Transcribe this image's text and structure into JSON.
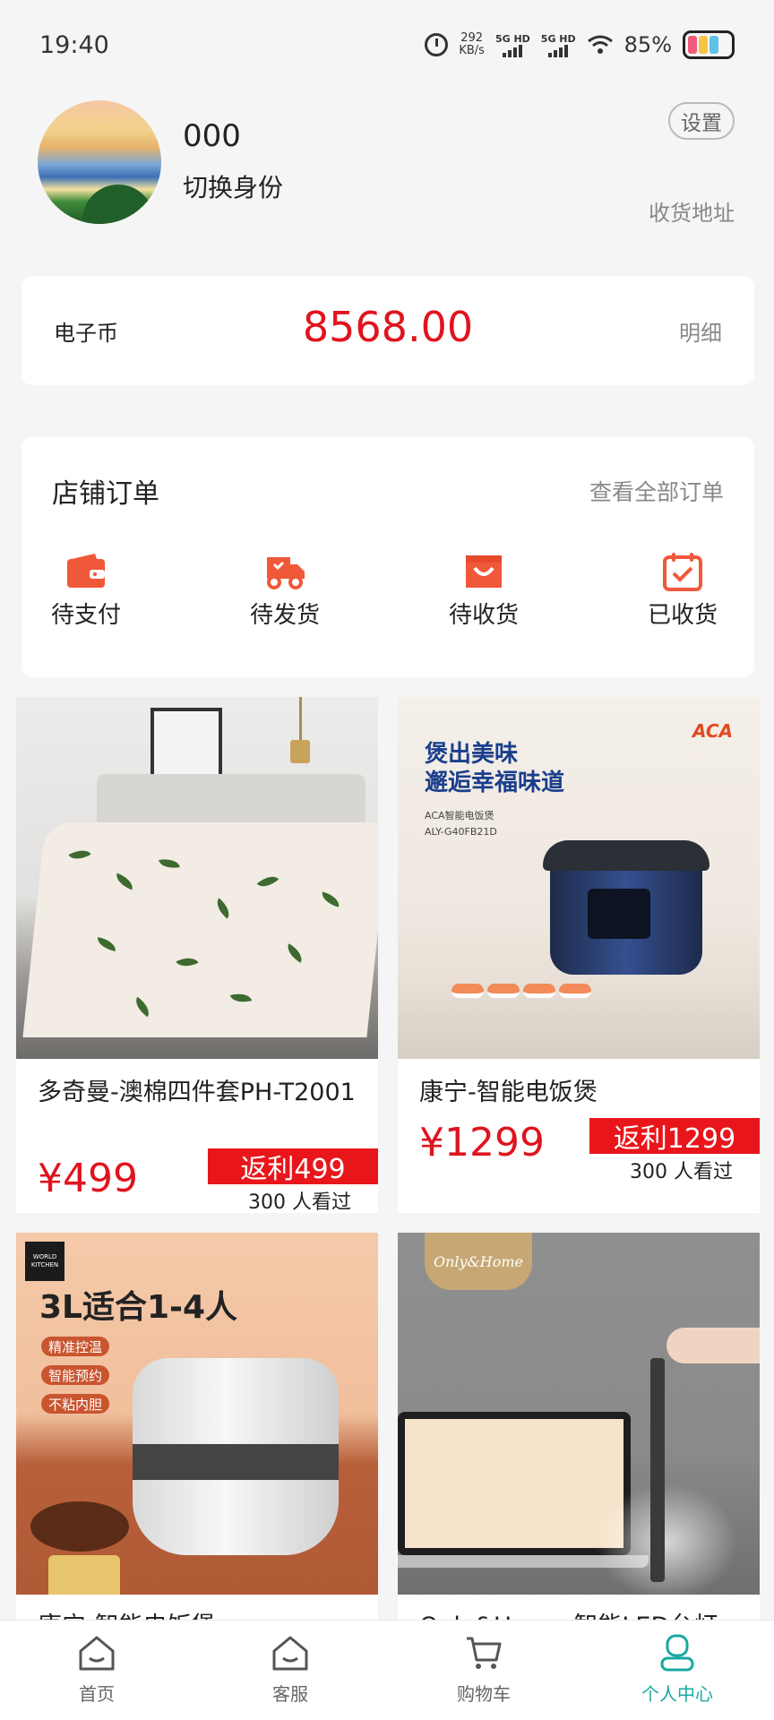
{
  "status_bar": {
    "time": "19:40",
    "speed_value": "292",
    "speed_unit": "KB/s",
    "sim1": "5G HD",
    "sim2": "5G HD",
    "battery": "85%"
  },
  "profile": {
    "username": "000",
    "switch_role": "切换身份",
    "settings": "设置",
    "address": "收货地址"
  },
  "coin": {
    "label": "电子币",
    "value": "8568.00",
    "detail": "明细"
  },
  "orders": {
    "title": "店铺订单",
    "view_all": "查看全部订单",
    "items": [
      {
        "label": "待支付",
        "icon": "wallet-icon"
      },
      {
        "label": "待发货",
        "icon": "delivery-truck-icon"
      },
      {
        "label": "待收货",
        "icon": "shopping-bag-icon"
      },
      {
        "label": "已收货",
        "icon": "calendar-check-icon"
      }
    ]
  },
  "products": [
    {
      "name": "多奇曼-澳棉四件套PH-T2001",
      "price": "¥499",
      "rebate": "返利499",
      "views": "300 人看过"
    },
    {
      "name": "康宁-智能电饭煲",
      "price": "¥1299",
      "rebate": "返利1299",
      "views": "300 人看过",
      "ad_brand": "ACA",
      "ad_line1": "煲出美味",
      "ad_line2": "邂逅幸福味道",
      "ad_small1": "ACA智能电饭煲",
      "ad_small2": "ALY-G40FB21D"
    },
    {
      "name": "康宁-智能电饭煲",
      "ad_logo": "WORLD KITCHEN",
      "ad_head": "3L适合1-4人",
      "ad_tags": [
        "精准控温",
        "智能预约",
        "不粘内胆"
      ]
    },
    {
      "name": "Only&Home-智能LED台灯",
      "ad_logo": "Only&Home"
    }
  ],
  "tabbar": {
    "items": [
      {
        "label": "首页",
        "icon": "home-icon"
      },
      {
        "label": "客服",
        "icon": "customer-service-icon"
      },
      {
        "label": "购物车",
        "icon": "cart-icon"
      },
      {
        "label": "个人中心",
        "icon": "profile-icon"
      }
    ],
    "active_color": "#19a8a0"
  },
  "colors": {
    "accent_red": "#e0141e",
    "icon_orange": "#f0583a"
  }
}
